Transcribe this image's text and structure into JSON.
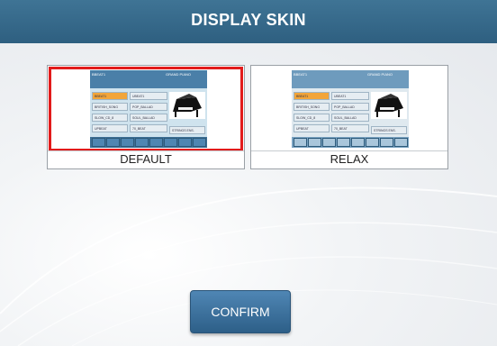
{
  "header": {
    "title": "DISPLAY SKIN"
  },
  "skins": [
    {
      "label": "DEFAULT",
      "selected": true
    },
    {
      "label": "RELAX",
      "selected": false
    }
  ],
  "thumbnail": {
    "top_left": "BBEAT1",
    "top_right": "GRAND PIANO",
    "cells_left": [
      "BBEAT1",
      "BRITISH_SONG",
      "SLOW_CD_8",
      "UPBEAT"
    ],
    "cells_mid": [
      "UBEAT1",
      "POP_BALLAD",
      "SOUL_BALLAD",
      "70_BEAT"
    ],
    "cell_right": "STRINGS ENS."
  },
  "colors": {
    "header": "#34678a",
    "selection": "#e21b1b",
    "button": "#3d73a0"
  },
  "confirm": {
    "label": "CONFIRM"
  }
}
